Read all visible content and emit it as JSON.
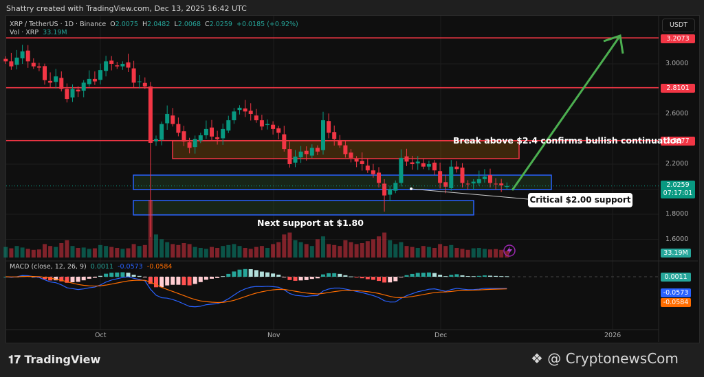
{
  "credit": "Shattry created with TradingView.com, Dec 13, 2025 16:42 UTC",
  "legend": {
    "symbol": "XRP / TetherUS · 1D · Binance",
    "o_label": "O",
    "o": "2.0075",
    "h_label": "H",
    "h": "2.0482",
    "l_label": "L",
    "l": "2.0068",
    "c_label": "C",
    "c": "2.0259",
    "change": "+0.0185 (+0.92%)",
    "vol_label": "Vol · XRP",
    "vol": "33.19M"
  },
  "macd_legend": {
    "label": "MACD (close, 12, 26, 9)",
    "hist": "0.0011",
    "macd": "-0.0573",
    "signal": "-0.0584"
  },
  "currency": "USDT",
  "price_ticks": [
    "3.0000",
    "2.6000",
    "2.2000",
    "1.8000",
    "1.6000"
  ],
  "price_labels": {
    "r1": "3.2073",
    "r2": "2.8101",
    "r3": "2.3877",
    "last": "2.0259",
    "countdown": "07:17:01",
    "vol": "33.19M",
    "hist": "0.0011",
    "macd": "-0.0573",
    "signal": "-0.0584"
  },
  "time_ticks": [
    "Oct",
    "Nov",
    "Dec",
    "2026"
  ],
  "annotations": {
    "bullish": "Break above $2.4 confirms bullish continuation",
    "critical": "Critical $2.00 support",
    "next": "Next support at $1.80"
  },
  "footer": {
    "brand": "TradingView",
    "watermark": "@ CryptonewsCom"
  },
  "colors": {
    "up": "#089981",
    "down": "#f23645",
    "resistance": "#f23645",
    "support_box": "#2962ff",
    "arrow": "#4caf50"
  },
  "chart_data": {
    "type": "candlestick",
    "start_date": "2025-09-14",
    "levels": [
      3.2073,
      2.8101,
      2.3877
    ],
    "closes": [
      3.02,
      2.98,
      3.05,
      3.1,
      3.02,
      2.98,
      2.97,
      2.87,
      2.85,
      2.9,
      2.8,
      2.72,
      2.8,
      2.78,
      2.85,
      2.88,
      2.86,
      2.95,
      3.02,
      3.0,
      2.98,
      3.0,
      2.97,
      2.85,
      2.86,
      2.82,
      2.37,
      2.4,
      2.52,
      2.6,
      2.52,
      2.45,
      2.38,
      2.33,
      2.4,
      2.43,
      2.48,
      2.42,
      2.4,
      2.48,
      2.55,
      2.62,
      2.65,
      2.62,
      2.6,
      2.55,
      2.5,
      2.52,
      2.48,
      2.45,
      2.32,
      2.2,
      2.26,
      2.3,
      2.28,
      2.33,
      2.3,
      2.55,
      2.45,
      2.4,
      2.35,
      2.28,
      2.25,
      2.22,
      2.2,
      2.15,
      2.12,
      2.05,
      1.95,
      2.0,
      2.05,
      2.25,
      2.22,
      2.2,
      2.22,
      2.18,
      2.2,
      2.15,
      2.05,
      2.02,
      2.18,
      2.16,
      2.05,
      2.04,
      2.06,
      2.08,
      2.1,
      2.05,
      2.04,
      2.03,
      2.0259
    ],
    "volumes_m": [
      55,
      48,
      60,
      52,
      45,
      40,
      42,
      70,
      60,
      55,
      75,
      90,
      60,
      50,
      52,
      45,
      48,
      65,
      60,
      55,
      50,
      45,
      48,
      70,
      60,
      65,
      300,
      120,
      95,
      80,
      70,
      65,
      75,
      70,
      55,
      50,
      45,
      55,
      50,
      60,
      65,
      70,
      60,
      50,
      45,
      55,
      60,
      50,
      70,
      80,
      120,
      130,
      90,
      80,
      70,
      60,
      95,
      110,
      70,
      65,
      60,
      90,
      80,
      70,
      75,
      85,
      95,
      110,
      130,
      90,
      70,
      80,
      60,
      55,
      50,
      60,
      55,
      50,
      70,
      60,
      65,
      50,
      45,
      40,
      48,
      50,
      45,
      42,
      44,
      40,
      33.19
    ]
  }
}
